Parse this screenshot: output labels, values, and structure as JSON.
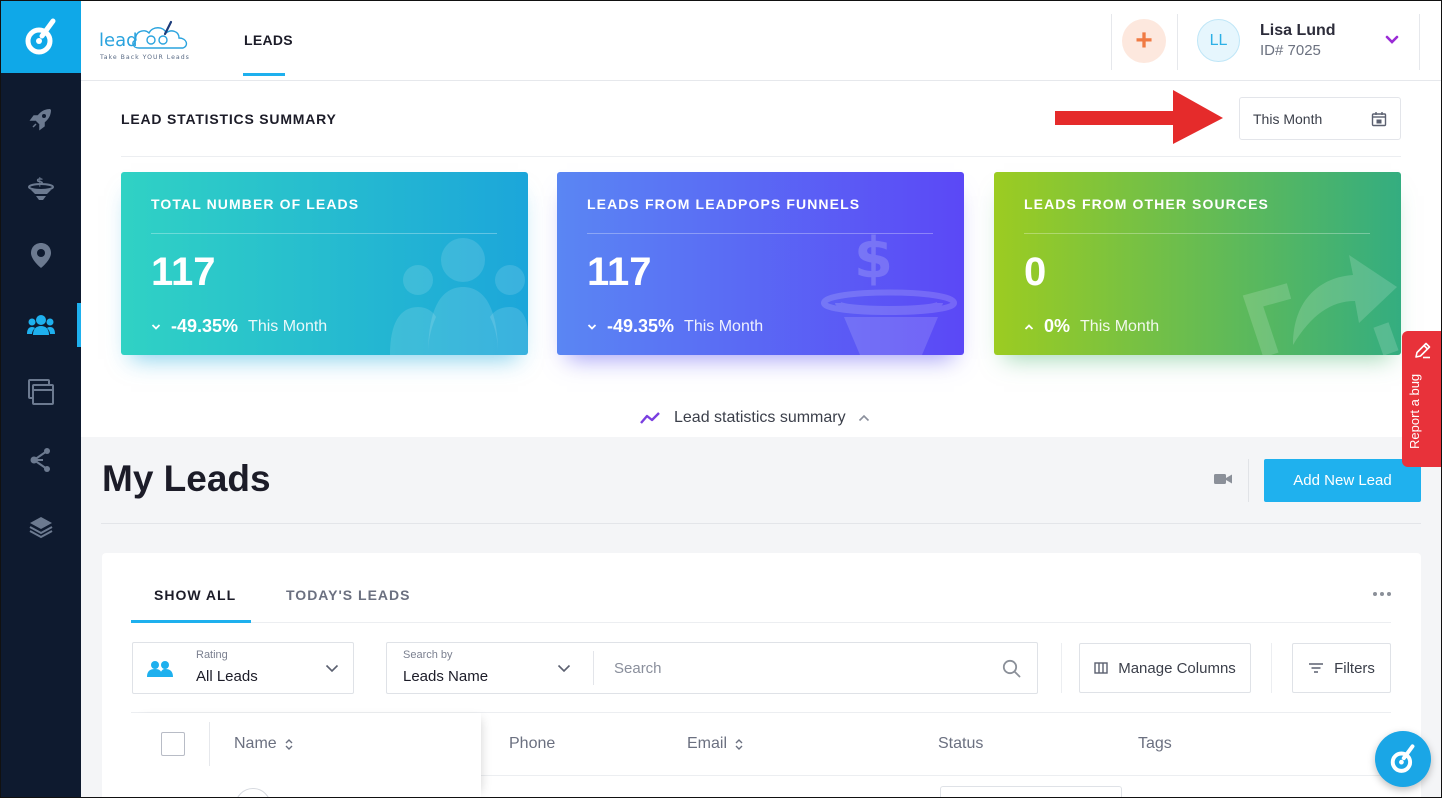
{
  "header": {
    "brand_text": "lead",
    "brand_tagline": "Take Back YOUR Leads",
    "nav_tab": "LEADS",
    "user_initials": "LL",
    "user_name": "Lisa Lund",
    "user_id": "ID# 7025"
  },
  "summary": {
    "title": "LEAD STATISTICS SUMMARY",
    "date_range": "This Month",
    "cards": [
      {
        "title": "TOTAL NUMBER OF LEADS",
        "value": "117",
        "change": "-49.35%",
        "direction": "down",
        "period": "This Month"
      },
      {
        "title": "LEADS FROM LEADPOPS FUNNELS",
        "value": "117",
        "change": "-49.35%",
        "direction": "down",
        "period": "This Month"
      },
      {
        "title": "LEADS FROM OTHER SOURCES",
        "value": "0",
        "change": "0%",
        "direction": "up",
        "period": "This Month"
      }
    ],
    "toggle_label": "Lead statistics summary"
  },
  "leads": {
    "title": "My Leads",
    "add_button": "Add New Lead",
    "tabs": [
      "SHOW ALL",
      "TODAY'S LEADS"
    ],
    "rating_label": "Rating",
    "rating_value": "All Leads",
    "search_by_label": "Search by",
    "search_by_value": "Leads Name",
    "search_placeholder": "Search",
    "manage_columns": "Manage Columns",
    "filters": "Filters",
    "columns": [
      "Name",
      "Phone",
      "Email",
      "Status",
      "Tags"
    ]
  },
  "bug_report": "Report a bug",
  "colors": {
    "accent": "#1eb0ee",
    "sidebar": "#0e1a2f",
    "annotation_arrow": "#e52b2b"
  },
  "icons": [
    "rocket-icon",
    "funnel-icon",
    "map-pin-icon",
    "users-icon",
    "windows-icon",
    "share-nodes-icon",
    "layers-icon",
    "calendar-icon",
    "video-icon",
    "search-icon",
    "chevron-down-icon",
    "sort-icon",
    "pencil-icon",
    "trend-icon"
  ]
}
